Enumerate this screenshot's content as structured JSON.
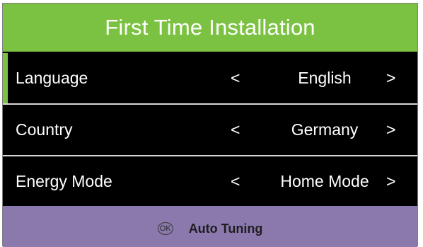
{
  "title": "First Time Installation",
  "colors": {
    "title_bg": "#7cc242",
    "menu_bg": "#000000",
    "footer_bg": "#8b78ad",
    "focus_marker": "#7cc242"
  },
  "settings": [
    {
      "label": "Language",
      "left_arrow": "<",
      "value": "English",
      "right_arrow": ">"
    },
    {
      "label": "Country",
      "left_arrow": "<",
      "value": "Germany",
      "right_arrow": ">"
    },
    {
      "label": "Energy Mode",
      "left_arrow": "<",
      "value": "Home Mode",
      "right_arrow": ">"
    }
  ],
  "footer": {
    "ok_icon_text": "OK",
    "action_label": "Auto Tuning"
  }
}
